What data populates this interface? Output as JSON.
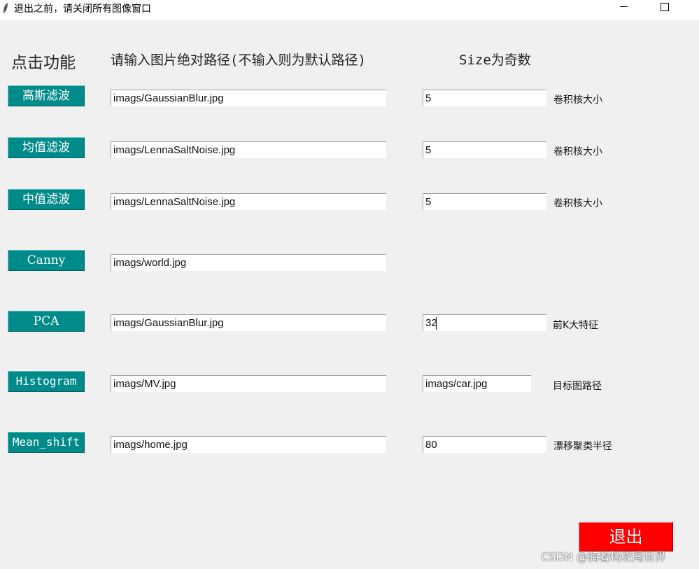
{
  "window": {
    "title": "退出之前，请关闭所有图像窗口",
    "icon": "feather-icon"
  },
  "headers": {
    "function": "点击功能",
    "path": "请输入图片绝对路径(不输入则为默认路径)",
    "size": "Size为奇数"
  },
  "rows": [
    {
      "button": "高斯滤波",
      "path": "imags/GaussianBlur.jpg",
      "param": "5",
      "param_label": "卷积核大小"
    },
    {
      "button": "均值滤波",
      "path": "imags/LennaSaltNoise.jpg",
      "param": "5",
      "param_label": "卷积核大小"
    },
    {
      "button": "中值滤波",
      "path": "imags/LennaSaltNoise.jpg",
      "param": "5",
      "param_label": "卷积核大小"
    },
    {
      "button": "Canny",
      "path": "imags/world.jpg"
    },
    {
      "button": "PCA",
      "path": "imags/GaussianBlur.jpg",
      "param": "32",
      "param_label": "前K大特征"
    },
    {
      "button": "Histogram",
      "path": "imags/MV.jpg",
      "param": "imags/car.jpg",
      "param_label": "目标图路径"
    },
    {
      "button": "Mean_shift",
      "path": "imags/home.jpg",
      "param": "80",
      "param_label": "漂移聚类半径"
    }
  ],
  "exit_label": "退出",
  "watermark": "CSDN @骑着蚂蚁闯世界",
  "colors": {
    "function_button": "#008b8b",
    "exit_button": "#ff0000",
    "background": "#f0f0f0"
  }
}
